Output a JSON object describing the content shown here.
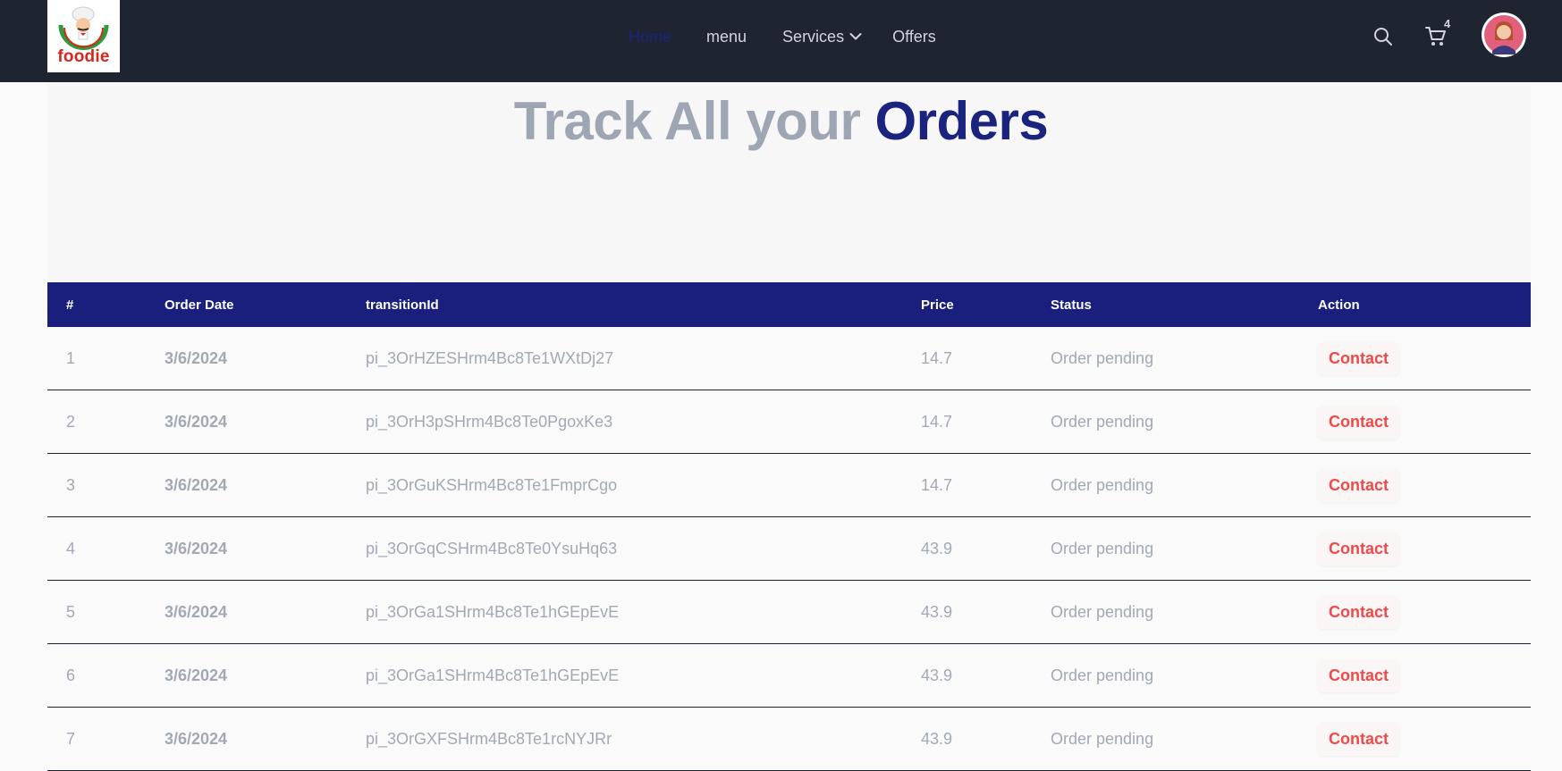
{
  "brand": {
    "logo_text": "foodie"
  },
  "nav": {
    "home": "Home",
    "menu": "menu",
    "services": "Services",
    "offers": "Offers"
  },
  "cart": {
    "count": "4"
  },
  "page": {
    "title_part1": "Track All your",
    "title_part2": "Orders"
  },
  "table": {
    "headers": [
      "#",
      "Order Date",
      "transitionId",
      "Price",
      "Status",
      "Action"
    ],
    "rows": [
      {
        "index": "1",
        "date": "3/6/2024",
        "transition_id": "pi_3OrHZESHrm4Bc8Te1WXtDj27",
        "price": "14.7",
        "status": "Order pending",
        "action": "Contact"
      },
      {
        "index": "2",
        "date": "3/6/2024",
        "transition_id": "pi_3OrH3pSHrm4Bc8Te0PgoxKe3",
        "price": "14.7",
        "status": "Order pending",
        "action": "Contact"
      },
      {
        "index": "3",
        "date": "3/6/2024",
        "transition_id": "pi_3OrGuKSHrm4Bc8Te1FmprCgo",
        "price": "14.7",
        "status": "Order pending",
        "action": "Contact"
      },
      {
        "index": "4",
        "date": "3/6/2024",
        "transition_id": "pi_3OrGqCSHrm4Bc8Te0YsuHq63",
        "price": "43.9",
        "status": "Order pending",
        "action": "Contact"
      },
      {
        "index": "5",
        "date": "3/6/2024",
        "transition_id": "pi_3OrGa1SHrm4Bc8Te1hGEpEvE",
        "price": "43.9",
        "status": "Order pending",
        "action": "Contact"
      },
      {
        "index": "6",
        "date": "3/6/2024",
        "transition_id": "pi_3OrGa1SHrm4Bc8Te1hGEpEvE",
        "price": "43.9",
        "status": "Order pending",
        "action": "Contact"
      },
      {
        "index": "7",
        "date": "3/6/2024",
        "transition_id": "pi_3OrGXFSHrm4Bc8Te1rcNYJRr",
        "price": "43.9",
        "status": "Order pending",
        "action": "Contact"
      }
    ]
  },
  "icons": {
    "search": "search-icon",
    "cart": "cart-icon",
    "avatar": "user-avatar",
    "chevron": "chevron-down-icon",
    "logo": "chef-logo"
  },
  "colors": {
    "navbar_bg": "#1f2530",
    "accent_navy": "#1a237e",
    "table_header_bg": "#1a1f7e",
    "muted_text": "#a2a9b5",
    "contact_red": "#ef4a4a",
    "logo_red": "#d5271b"
  }
}
